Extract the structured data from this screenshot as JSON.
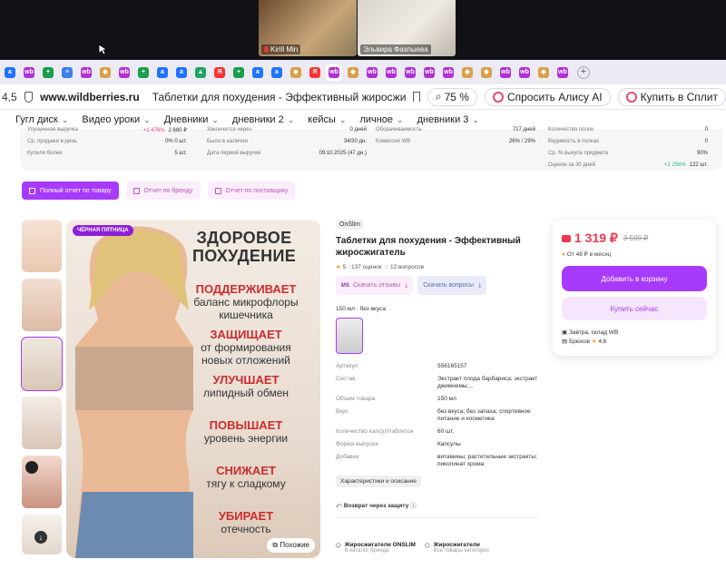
{
  "call": {
    "participants": [
      {
        "name": "Kirill Min",
        "muted": true
      },
      {
        "name": "Эльвира Фазлыева",
        "muted": false
      }
    ]
  },
  "tabs": [
    {
      "icon": "yandex-a",
      "label": "a",
      "color": "#1e73ff"
    },
    {
      "icon": "wb",
      "label": "wb",
      "color": "#b12fd6"
    },
    {
      "icon": "sheets",
      "label": "+",
      "color": "#1a9e4b"
    },
    {
      "icon": "docs",
      "label": "≡",
      "color": "#3b7df0"
    },
    {
      "icon": "wb",
      "label": "wb",
      "color": "#b12fd6"
    },
    {
      "icon": "shop",
      "label": "◆",
      "color": "#d9a14b"
    },
    {
      "icon": "wb",
      "label": "wb",
      "color": "#b12fd6"
    },
    {
      "icon": "sheets",
      "label": "+",
      "color": "#1a9e4b"
    },
    {
      "icon": "yandex-a",
      "label": "a",
      "color": "#1e73ff"
    },
    {
      "icon": "yandex-a",
      "label": "a",
      "color": "#1e73ff"
    },
    {
      "icon": "drive",
      "label": "▲",
      "color": "#1fa463"
    },
    {
      "icon": "yandex",
      "label": "Я",
      "color": "#ff3333"
    },
    {
      "icon": "sheets",
      "label": "+",
      "color": "#1a9e4b"
    },
    {
      "icon": "yandex-a",
      "label": "a",
      "color": "#1e73ff"
    },
    {
      "icon": "yandex-a",
      "label": "a",
      "color": "#1e73ff"
    },
    {
      "icon": "shop",
      "label": "◆",
      "color": "#d9a14b"
    },
    {
      "icon": "yandex",
      "label": "Я",
      "color": "#ff3333"
    },
    {
      "icon": "wb",
      "label": "wb",
      "color": "#b12fd6",
      "active": true
    },
    {
      "icon": "shop",
      "label": "◆",
      "color": "#d9a14b"
    },
    {
      "icon": "wb",
      "label": "wb",
      "color": "#b12fd6"
    },
    {
      "icon": "wb",
      "label": "wb",
      "color": "#b12fd6"
    },
    {
      "icon": "wb",
      "label": "wb",
      "color": "#b12fd6"
    },
    {
      "icon": "wb",
      "label": "wb",
      "color": "#b12fd6"
    },
    {
      "icon": "wb",
      "label": "wb",
      "color": "#b12fd6"
    },
    {
      "icon": "shop",
      "label": "◆",
      "color": "#d9a14b"
    },
    {
      "icon": "shop",
      "label": "◆",
      "color": "#d9a14b"
    },
    {
      "icon": "wb",
      "label": "wb",
      "color": "#b12fd6"
    },
    {
      "icon": "wb",
      "label": "wb",
      "color": "#b12fd6"
    },
    {
      "icon": "shop",
      "label": "◆",
      "color": "#d9a14b"
    },
    {
      "icon": "wb",
      "label": "wb",
      "color": "#b12fd6"
    }
  ],
  "address": {
    "left_number": "4,5",
    "url": "www.wildberries.ru",
    "page_title": "Таблетки для похудения - Эффективный жиросжигател...",
    "zoom": "75 %",
    "alice_label": "Спросить Алису AI",
    "split_label": "Купить в Сплит"
  },
  "bookmarks": [
    "Гугл диск",
    "Видео уроки",
    "Дневники",
    "дневники 2",
    "кейсы",
    "личное",
    "дневники 3"
  ],
  "stats": {
    "col1": [
      {
        "k": "Упущенная выручка",
        "v": "2 680 ₽",
        "delta": "+1 476%"
      },
      {
        "k": "Ср. продажи в день",
        "v": "0% 0 шт."
      },
      {
        "k": "Купили более",
        "v": "5 шт."
      }
    ],
    "col2": [
      {
        "k": "Закончится через",
        "v": "0 дней"
      },
      {
        "k": "Было в наличии",
        "v": "34/30 дн."
      },
      {
        "k": "Дата первой выручки",
        "v": "09.10.2025 (47 дн.)"
      }
    ],
    "col3": [
      {
        "k": "Оборачиваемость",
        "v": "717 дней"
      },
      {
        "k": "Комиссия WB",
        "v": "26% / 29%"
      }
    ],
    "col4": [
      {
        "k": "Количество полок",
        "v": "0"
      },
      {
        "k": "Видимость в полках",
        "v": "0"
      },
      {
        "k": "Ср. % выкупа предмета",
        "v": "90%"
      },
      {
        "k": "Оценок за 30 дней",
        "v": "122 шт.",
        "delta": "+1 256%"
      }
    ]
  },
  "actions": [
    "Полный отчет по товару",
    "Отчет по бренду",
    "Отчет по поставщику"
  ],
  "image": {
    "promo_badge": "ЧЁРНАЯ ПЯТНИЦА",
    "headline": [
      "ЗДОРОВОЕ",
      "ПОХУДЕНИЕ"
    ],
    "benefits": [
      {
        "verb": "ПОДДЕРЖИВАЕТ",
        "line1": "баланс микрофлоры",
        "line2": "кишечника"
      },
      {
        "verb": "ЗАЩИЩАЕТ",
        "line1": "от формирования",
        "line2": "новых отложений"
      },
      {
        "verb": "УЛУЧШАЕТ",
        "line1": "липидный обмен",
        "line2": ""
      },
      {
        "verb": "ПОВЫШАЕТ",
        "line1": "уровень энергии",
        "line2": ""
      },
      {
        "verb": "СНИЖАЕТ",
        "line1": "тягу к сладкому",
        "line2": ""
      },
      {
        "verb": "УБИРАЕТ",
        "line1": "отечность",
        "line2": ""
      }
    ],
    "similar_label": "Похожие"
  },
  "product": {
    "brand": "OnSlim",
    "title": "Таблетки для похудения - Эффективный жиросжигатель",
    "rating": "5",
    "reviews": "137 оценок",
    "questions": "12 вопросов",
    "btn_reviews": "Скачать отзывы",
    "btn_questions": "Скачать вопросы",
    "volume_label": "150 мл · без вкуса",
    "specs": [
      {
        "k": "Артикул",
        "v": "556165157"
      },
      {
        "k": "Состав",
        "v": "Экстракт плода барбариса; экстракт джимнемы;..."
      },
      {
        "k": "Объем товара",
        "v": "150 мл"
      },
      {
        "k": "Вкус",
        "v": "без вкуса; без запаха; спортивное питание и косметика"
      },
      {
        "k": "Количество капсул/таблеток",
        "v": "60 шт."
      },
      {
        "k": "Форма выпуска",
        "v": "Капсулы"
      },
      {
        "k": "Добавки",
        "v": "витамины; растительные экстракты; пиколинат хрома"
      }
    ],
    "desc_button": "Характеристики и описание",
    "return_label": "Возврат через защиту",
    "categories": [
      {
        "title": "Жиросжигатели ONSLIM",
        "sub": "В каталог бренда"
      },
      {
        "title": "Жиросжигатели",
        "sub": "Все товары категории"
      }
    ]
  },
  "buy": {
    "price": "1 319 ₽",
    "old_price": "3 500 ₽",
    "monthly": "От 48 ₽ в месяц",
    "add_to_cart": "Добавить в корзину",
    "buy_now": "Купить сейчас",
    "delivery": "Завтра, склад WB",
    "seller": "Брюхов",
    "seller_rating": "4,6"
  }
}
